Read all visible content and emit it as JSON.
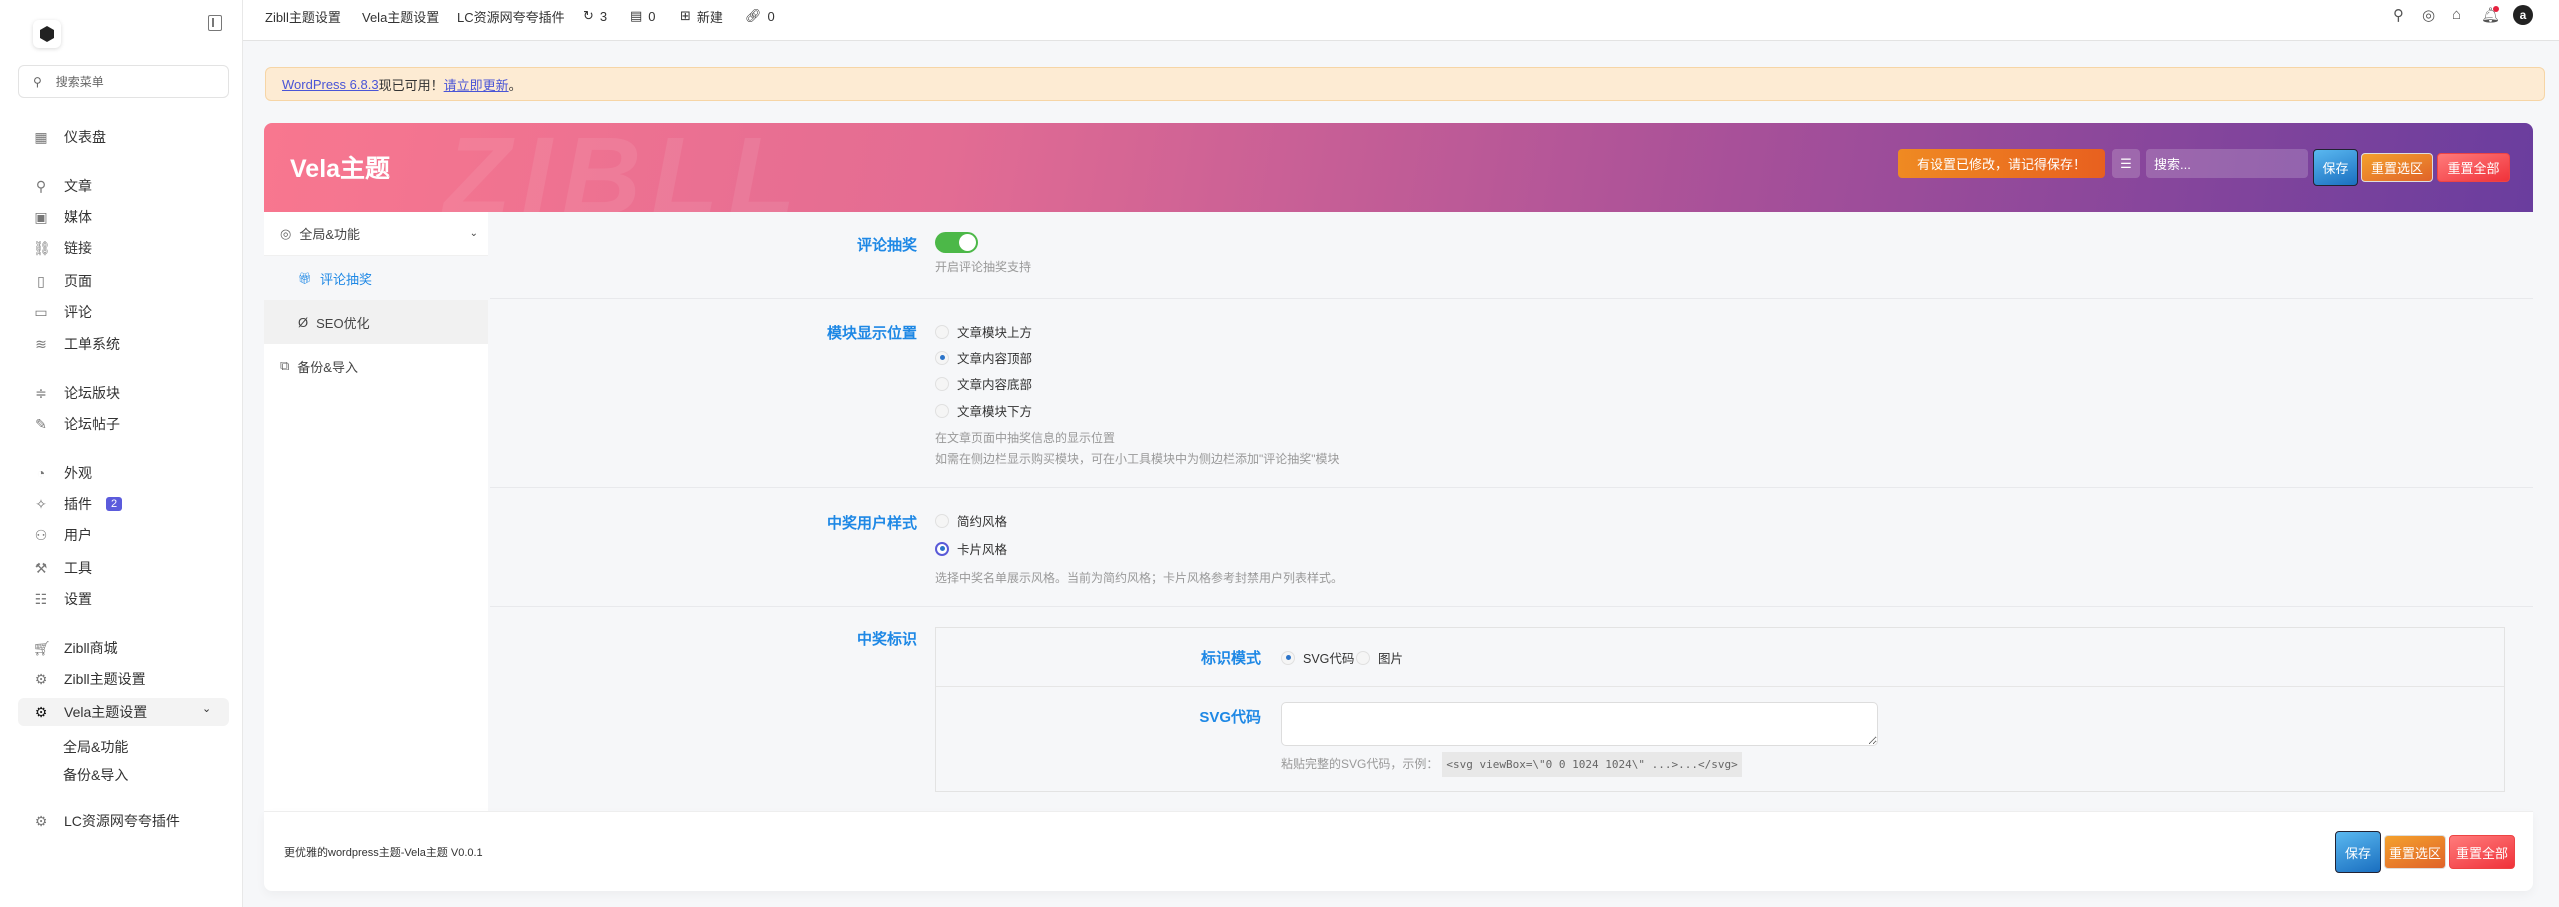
{
  "topbar": {
    "items": [
      "Zibll主题设置",
      "Vela主题设置",
      "LC资源网夸夸插件"
    ],
    "updates": "3",
    "comments": "0",
    "new": "新建",
    "links": "0",
    "avatar": "a"
  },
  "sidebar": {
    "search_placeholder": "搜索菜单",
    "items": [
      {
        "label": "仪表盘",
        "icon": "dashboard-icon"
      },
      {
        "label": "文章",
        "icon": "pin-icon"
      },
      {
        "label": "媒体",
        "icon": "media-icon"
      },
      {
        "label": "链接",
        "icon": "link-icon"
      },
      {
        "label": "页面",
        "icon": "page-icon"
      },
      {
        "label": "评论",
        "icon": "comment-icon"
      },
      {
        "label": "工单系统",
        "icon": "ticket-icon"
      },
      {
        "label": "论坛版块",
        "icon": "forum-icon"
      },
      {
        "label": "论坛帖子",
        "icon": "post-icon"
      },
      {
        "label": "外观",
        "icon": "palette-icon"
      },
      {
        "label": "插件",
        "icon": "plugin-icon",
        "badge": "2"
      },
      {
        "label": "用户",
        "icon": "users-icon"
      },
      {
        "label": "工具",
        "icon": "wrench-icon"
      },
      {
        "label": "设置",
        "icon": "sliders-icon"
      },
      {
        "label": "Zibll商城",
        "icon": "cart-icon"
      },
      {
        "label": "Zibll主题设置",
        "icon": "gear-icon"
      },
      {
        "label": "Vela主题设置",
        "icon": "gear-icon"
      },
      {
        "label": "LC资源网夸夸插件",
        "icon": "gear-icon"
      }
    ],
    "submenu": [
      "全局&功能",
      "备份&导入"
    ]
  },
  "notice": {
    "link": "WordPress 6.8.3",
    "text": " 现已可用！",
    "action": "请立即更新",
    "end": "。"
  },
  "panel": {
    "title": "Vela主题",
    "watermark": "ZIBLL",
    "changed": "有设置已修改，请记得保存！",
    "search_placeholder": "搜索...",
    "save": "保存",
    "reset_section": "重置选区",
    "reset_all": "重置全部",
    "nav": {
      "global": "全局&功能",
      "lottery": "评论抽奖",
      "seo": "SEO优化",
      "backup": "备份&导入"
    }
  },
  "fields": {
    "enable": {
      "label": "评论抽奖",
      "hint": "开启评论抽奖支持",
      "on": true
    },
    "position": {
      "label": "模块显示位置",
      "options": [
        "文章模块上方",
        "文章内容顶部",
        "文章内容底部",
        "文章模块下方"
      ],
      "selected": 1,
      "hint1": "在文章页面中抽奖信息的显示位置",
      "hint2": "如需在侧边栏显示购买模块，可在小工具模块中为侧边栏添加\"评论抽奖\"模块"
    },
    "style": {
      "label": "中奖用户样式",
      "options": [
        "简约风格",
        "卡片风格"
      ],
      "selected": 1,
      "hint": "选择中奖名单展示风格。当前为简约风格；卡片风格参考封禁用户列表样式。"
    },
    "badge": {
      "label": "中奖标识",
      "mode_label": "标识模式",
      "modes": [
        "SVG代码",
        "图片"
      ],
      "svg_label": "SVG代码",
      "svg_value": "",
      "hint": "粘贴完整的SVG代码，示例：",
      "code": "<svg viewBox=\\\"0 0 1024 1024\\\" ...>...</svg>"
    }
  },
  "footer": {
    "text": "更优雅的wordpress主题-Vela主题 V0.0.1"
  }
}
